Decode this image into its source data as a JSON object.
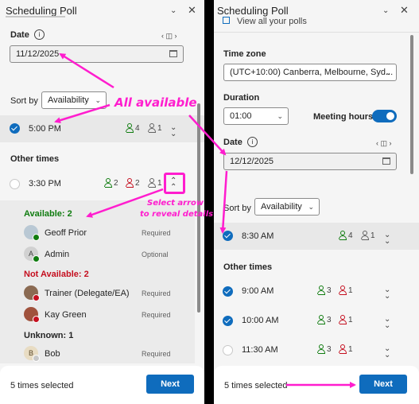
{
  "left": {
    "title": "Scheduling Poll",
    "date_label": "Date",
    "date_value": "11/12/2025",
    "sortby_label": "Sort by",
    "sortby_value": "Availability",
    "selected_time": {
      "time": "5:00 PM",
      "accept": "4",
      "unknown": "1"
    },
    "other_times_label": "Other times",
    "other_time": {
      "time": "3:30 PM",
      "accept": "2",
      "decline": "2",
      "unknown": "1"
    },
    "available_heading": "Available: 2",
    "available": [
      {
        "name": "Geoff Prior",
        "role": "Required"
      },
      {
        "name": "Admin",
        "role": "Optional",
        "initial": "A"
      }
    ],
    "not_available_heading": "Not Available: 2",
    "not_available": [
      {
        "name": "Trainer (Delegate/EA)",
        "role": "Required"
      },
      {
        "name": "Kay Green",
        "role": "Required"
      }
    ],
    "unknown_heading": "Unknown: 1",
    "unknown": [
      {
        "name": "Bob",
        "role": "Required",
        "initial": "B"
      }
    ],
    "footer_text": "5 times selected",
    "next_label": "Next"
  },
  "right": {
    "title": "Scheduling Poll",
    "view_all": "View all your polls",
    "timezone_label": "Time zone",
    "timezone_value": "(UTC+10:00) Canberra, Melbourne, Syd...",
    "duration_label": "Duration",
    "duration_value": "01:00",
    "meeting_hours_label": "Meeting hours",
    "date_label": "Date",
    "date_value": "12/12/2025",
    "sortby_label": "Sort by",
    "sortby_value": "Availability",
    "selected_time": {
      "time": "8:30 AM",
      "accept": "4",
      "unknown": "1"
    },
    "other_times_label": "Other times",
    "other_times": [
      {
        "time": "9:00 AM",
        "accept": "3",
        "decline": "1",
        "checked": true
      },
      {
        "time": "10:00 AM",
        "accept": "3",
        "decline": "1",
        "checked": true
      },
      {
        "time": "11:30 AM",
        "accept": "3",
        "decline": "1",
        "checked": false
      }
    ],
    "footer_text": "5 times selected",
    "next_label": "Next"
  },
  "annotations": {
    "all_available": "All available",
    "select_arrow_1": "Select arrow",
    "select_arrow_2": "to reveal details"
  },
  "colors": {
    "accent": "#0f6cbd",
    "annotation": "#ff1dce",
    "available": "#107c10",
    "not_available": "#c50f1f"
  },
  "icons": {
    "minimize": "chevron-down-icon",
    "close": "close-icon",
    "info": "info-icon",
    "calendar": "calendar-icon",
    "expand": "chevron-double-down-icon",
    "collapse": "chevron-double-up-icon",
    "open_link": "open-link-icon"
  },
  "toggles": {
    "meeting_hours": true
  }
}
